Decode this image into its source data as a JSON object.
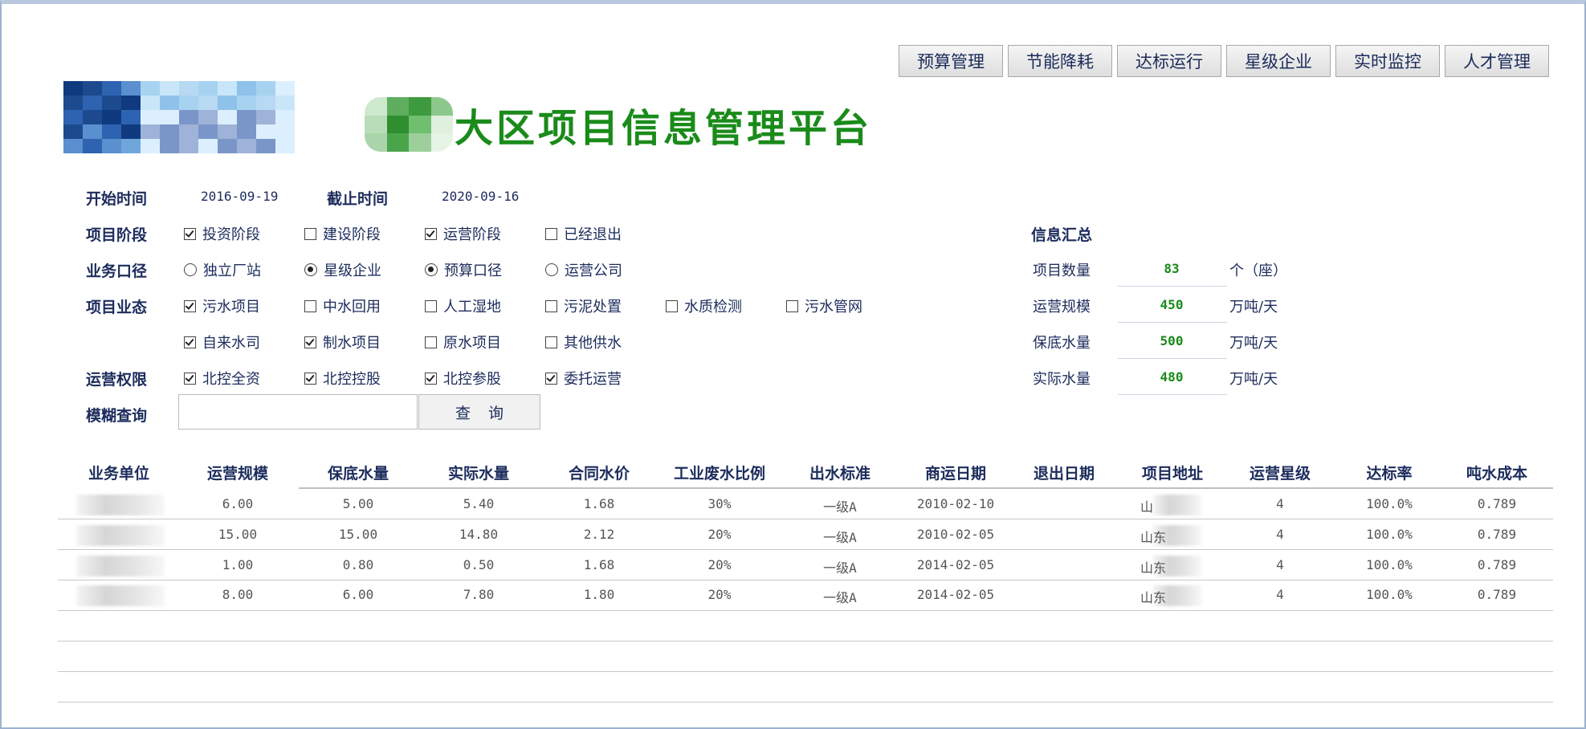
{
  "nav": [
    "预算管理",
    "节能降耗",
    "达标运行",
    "星级企业",
    "实时监控",
    "人才管理"
  ],
  "title": "大区项目信息管理平台",
  "filters": {
    "start_label": "开始时间",
    "start_value": "2016-09-19",
    "end_label": "截止时间",
    "end_value": "2020-09-16",
    "stage_label": "项目阶段",
    "stages": [
      {
        "label": "投资阶段",
        "checked": true
      },
      {
        "label": "建设阶段",
        "checked": false
      },
      {
        "label": "运营阶段",
        "checked": true
      },
      {
        "label": "已经退出",
        "checked": false
      }
    ],
    "scope_label": "业务口径",
    "scopes_a": [
      {
        "label": "独立厂站",
        "checked": false
      },
      {
        "label": "星级企业",
        "checked": true
      }
    ],
    "scopes_b": [
      {
        "label": "预算口径",
        "checked": true
      },
      {
        "label": "运营公司",
        "checked": false
      }
    ],
    "type_label": "项目业态",
    "types_row1": [
      {
        "label": "污水项目",
        "checked": true
      },
      {
        "label": "中水回用",
        "checked": false
      },
      {
        "label": "人工湿地",
        "checked": false
      },
      {
        "label": "污泥处置",
        "checked": false
      },
      {
        "label": "水质检测",
        "checked": false
      },
      {
        "label": "污水管网",
        "checked": false
      }
    ],
    "types_row2": [
      {
        "label": "自来水司",
        "checked": true
      },
      {
        "label": "制水项目",
        "checked": true
      },
      {
        "label": "原水项目",
        "checked": false
      },
      {
        "label": "其他供水",
        "checked": false
      }
    ],
    "auth_label": "运营权限",
    "auths": [
      {
        "label": "北控全资",
        "checked": true
      },
      {
        "label": "北控控股",
        "checked": true
      },
      {
        "label": "北控参股",
        "checked": true
      },
      {
        "label": "委托运营",
        "checked": true
      }
    ],
    "fuzzy_label": "模糊查询",
    "fuzzy_value": "",
    "search_label": "查询"
  },
  "summary": {
    "title": "信息汇总",
    "rows": [
      {
        "label": "项目数量",
        "value": "83",
        "unit": "个（座）"
      },
      {
        "label": "运营规模",
        "value": "450",
        "unit": "万吨/天"
      },
      {
        "label": "保底水量",
        "value": "500",
        "unit": "万吨/天"
      },
      {
        "label": "实际水量",
        "value": "480",
        "unit": "万吨/天"
      }
    ]
  },
  "table": {
    "headers": [
      "业务单位",
      "运营规模",
      "保底水量",
      "实际水量",
      "合同水价",
      "工业废水比例",
      "出水标准",
      "商运日期",
      "退出日期",
      "项目地址",
      "运营星级",
      "达标率",
      "吨水成本"
    ],
    "rows": [
      [
        "",
        "6.00",
        "5.00",
        "5.40",
        "1.68",
        "30%",
        "一级A",
        "2010-02-10",
        "",
        "山",
        "4",
        "100.0%",
        "0.789"
      ],
      [
        "",
        "15.00",
        "15.00",
        "14.80",
        "2.12",
        "20%",
        "一级A",
        "2010-02-05",
        "",
        "山东",
        "4",
        "100.0%",
        "0.789"
      ],
      [
        "",
        "1.00",
        "0.80",
        "0.50",
        "1.68",
        "20%",
        "一级A",
        "2014-02-05",
        "",
        "山东",
        "4",
        "100.0%",
        "0.789"
      ],
      [
        "",
        "8.00",
        "6.00",
        "7.80",
        "1.80",
        "20%",
        "一级A",
        "2014-02-05",
        "",
        "山东",
        "4",
        "100.0%",
        "0.789"
      ]
    ]
  },
  "colors": {
    "accent_green": "#1a8b1a",
    "label_navy": "#1c2c5c"
  }
}
